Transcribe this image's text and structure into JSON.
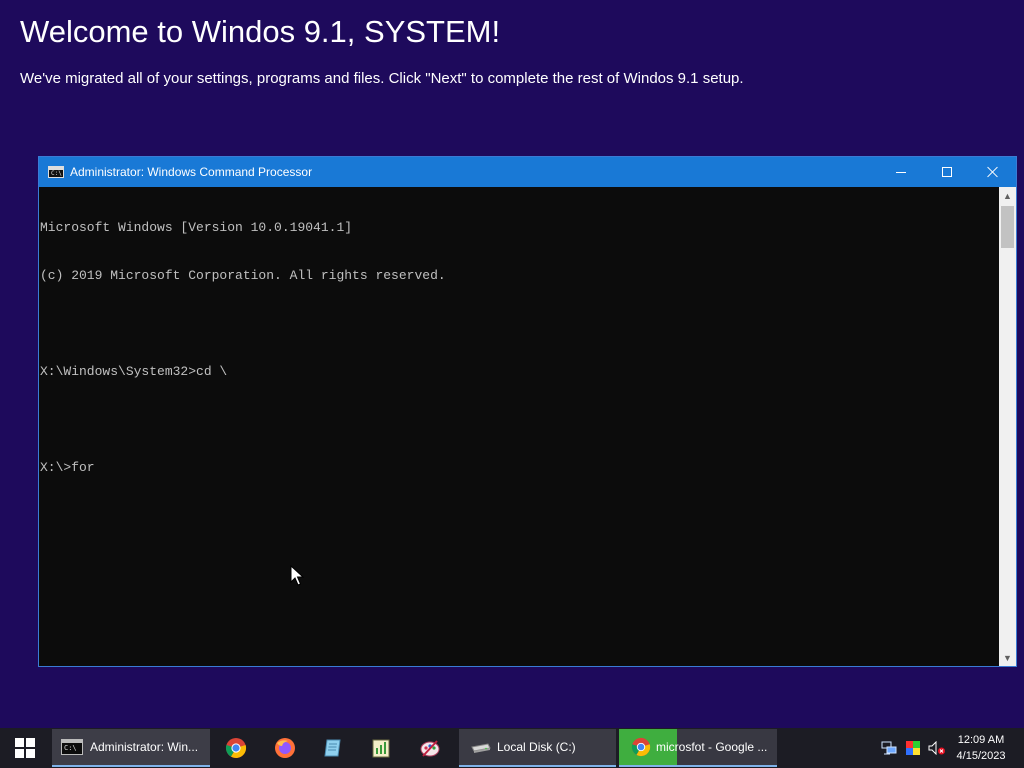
{
  "oobe": {
    "title": "Welcome to Windos 9.1, SYSTEM!",
    "subtitle": "We've migrated all of your settings, programs and files. Click \"Next\" to complete the rest of Windos 9.1 setup."
  },
  "console": {
    "title": "Administrator: Windows Command Processor",
    "icon": "cmd-icon",
    "lines": [
      "Microsoft Windows [Version 10.0.19041.1]",
      "(c) 2019 Microsoft Corporation. All rights reserved.",
      "",
      "X:\\Windows\\System32>cd \\",
      "",
      "X:\\>for"
    ]
  },
  "taskbar": {
    "start_icon": "windows-logo-icon",
    "tasks": [
      {
        "label": "Administrator: Win...",
        "icon": "cmd-icon"
      },
      {
        "label": "Local Disk (C:)",
        "icon": "drive-icon"
      },
      {
        "label": "microsfot - Google ...",
        "icon": "chrome-icon"
      }
    ],
    "pinned": [
      "chrome-icon",
      "firefox-icon",
      "notepad-icon",
      "ramdisk-icon",
      "paint-icon"
    ],
    "clock": {
      "time": "12:09 AM",
      "date": "4/15/2023"
    }
  },
  "colors": {
    "background": "#1e0a5c",
    "titlebar": "#1979d6",
    "console_bg": "#0c0c0c",
    "console_text": "#c0c0c0",
    "taskbar": "#1c1c24"
  }
}
